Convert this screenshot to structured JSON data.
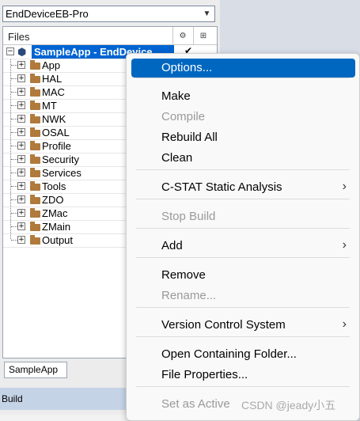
{
  "workspace": {
    "configuration": "EndDeviceEB-Pro",
    "header": {
      "files": "Files",
      "col1": "⚙",
      "col2": "⊞"
    },
    "root": {
      "label": "SampleApp - EndDevice",
      "check": "✔"
    },
    "nodes": [
      {
        "label": "App"
      },
      {
        "label": "HAL"
      },
      {
        "label": "MAC"
      },
      {
        "label": "MT"
      },
      {
        "label": "NWK"
      },
      {
        "label": "OSAL"
      },
      {
        "label": "Profile"
      },
      {
        "label": "Security"
      },
      {
        "label": "Services"
      },
      {
        "label": "Tools"
      },
      {
        "label": "ZDO"
      },
      {
        "label": "ZMac"
      },
      {
        "label": "ZMain"
      },
      {
        "label": "Output"
      }
    ],
    "tab": "SampleApp",
    "build_label": "Build"
  },
  "context_menu": {
    "items": [
      {
        "label": "Options...",
        "state": "highlighted"
      },
      {
        "label": "Make",
        "state": "enabled"
      },
      {
        "label": "Compile",
        "state": "disabled"
      },
      {
        "label": "Rebuild All",
        "state": "enabled"
      },
      {
        "label": "Clean",
        "state": "enabled"
      },
      {
        "label": "C-STAT Static Analysis",
        "state": "enabled",
        "submenu": true
      },
      {
        "label": "Stop Build",
        "state": "disabled"
      },
      {
        "label": "Add",
        "state": "enabled",
        "submenu": true
      },
      {
        "label": "Remove",
        "state": "enabled"
      },
      {
        "label": "Rename...",
        "state": "disabled"
      },
      {
        "label": "Version Control System",
        "state": "enabled",
        "submenu": true
      },
      {
        "label": "Open Containing Folder...",
        "state": "enabled"
      },
      {
        "label": "File Properties...",
        "state": "enabled"
      },
      {
        "label": "Set as Active",
        "state": "disabled"
      }
    ],
    "submenu_glyph": "›"
  },
  "watermark": "CSDN @jeady小五",
  "colors": {
    "highlight": "#0067c0",
    "selection": "#0064d2",
    "folder": "#b07a3c"
  }
}
